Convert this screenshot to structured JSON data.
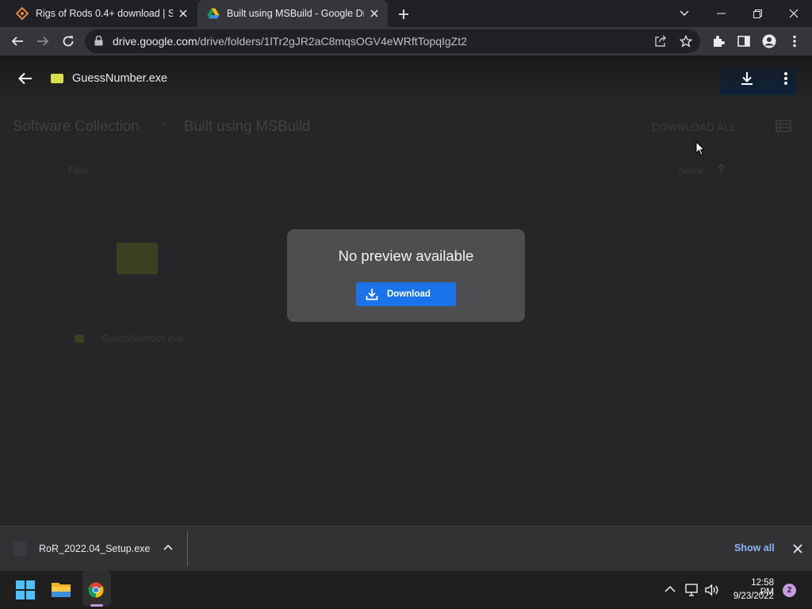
{
  "browser": {
    "tabs": [
      {
        "title": "Rigs of Rods 0.4+ download | So",
        "favicon": "rigs-of-rods-icon",
        "active": false
      },
      {
        "title": "Built using MSBuild - Google Driv",
        "favicon": "google-drive-icon",
        "active": true
      }
    ],
    "url_host": "drive.google.com",
    "url_path": "/drive/folders/1lTr2gJR2aC8mqsOGV4eWRftTopqIgZt2"
  },
  "preview": {
    "file_title": "GuessNumber.exe",
    "dialog_title": "No preview available",
    "download_label": "Download"
  },
  "drive": {
    "breadcrumb_root": "Software Collection",
    "breadcrumb_current": "Built using MSBuild",
    "download_all": "DOWNLOAD ALL",
    "files_label": "Files",
    "sort_label": "Name",
    "file_name": "GuessNumber.exe"
  },
  "download_shelf": {
    "file_name": "RoR_2022.04_Setup.exe",
    "show_all": "Show all"
  },
  "taskbar": {
    "time": "12:58 PM",
    "date": "9/23/2022",
    "notification_count": "2"
  },
  "colors": {
    "accent_blue": "#1a73e8",
    "link_blue": "#8ab4f8",
    "drive_file_yellow": "#d6e04a"
  }
}
